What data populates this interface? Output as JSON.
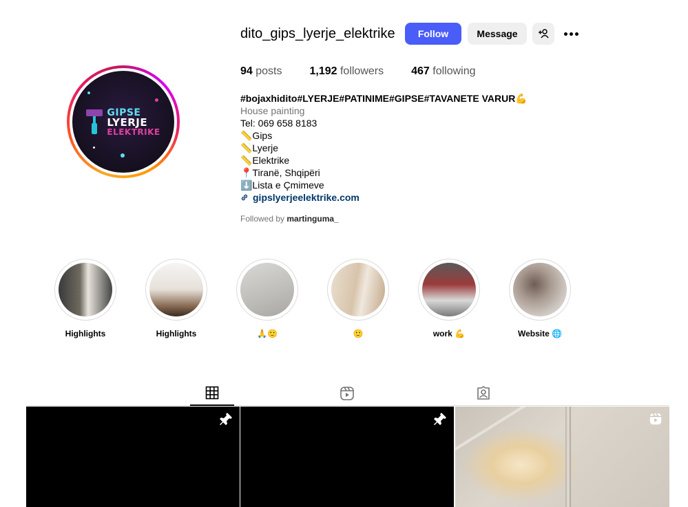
{
  "profile": {
    "username": "dito_gips_lyerje_elektrike",
    "follow_label": "Follow",
    "message_label": "Message",
    "avatar_text": [
      "GIPSE",
      "LYERJE",
      "ELEKTRIKE"
    ]
  },
  "stats": {
    "posts_count": "94",
    "posts_label": " posts",
    "followers_count": "1,192",
    "followers_label": " followers",
    "following_count": "467",
    "following_label": " following"
  },
  "bio": {
    "title": "#bojaxhidito#LYERJE#PATINIME#GIPSE#TAVANETE VARUR💪",
    "category": "House painting",
    "lines": [
      "Tel: 069 658 8183",
      "📏Gips",
      "📏Lyerje",
      "📏Elektrike",
      "📍Tiranë, Shqipëri",
      "⬇️Lista e Çmimeve"
    ],
    "link": "gipslyerjeelektrike.com",
    "followed_by_prefix": "Followed by ",
    "followed_by_user": "martinguma_"
  },
  "highlights": [
    {
      "label": "Highlights"
    },
    {
      "label": "Highlights"
    },
    {
      "label": "🙏🙂"
    },
    {
      "label": "🙂"
    },
    {
      "label": "work 💪"
    },
    {
      "label": "Website 🌐"
    }
  ],
  "tabs": [
    "grid-icon",
    "reels-icon",
    "tagged-icon"
  ],
  "posts": [
    {
      "icon": "pin-icon"
    },
    {
      "icon": "pin-icon"
    },
    {
      "icon": "reel-icon"
    }
  ],
  "colors": {
    "follow_button": "#4a5df9",
    "secondary_button": "#efefef",
    "link": "#00376b"
  }
}
